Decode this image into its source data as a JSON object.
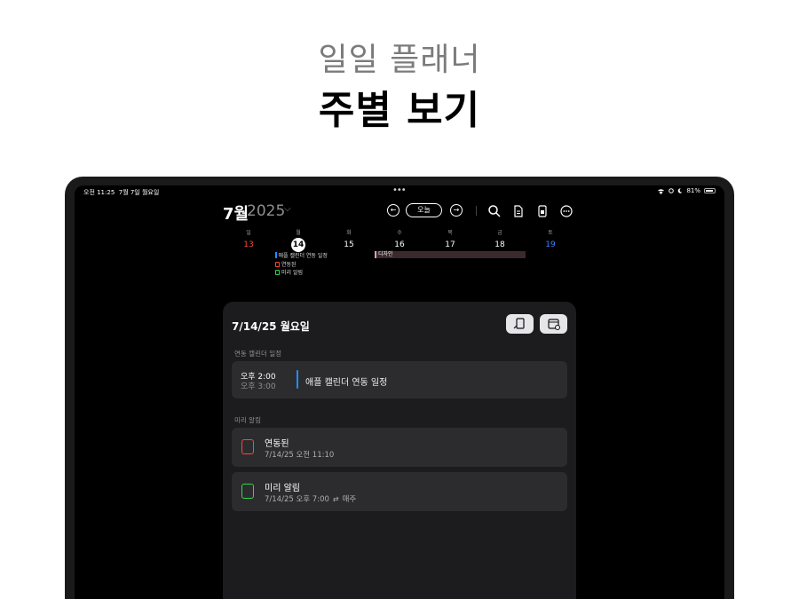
{
  "hero": {
    "subtitle": "일일 플래너",
    "title": "주별 보기"
  },
  "status_bar": {
    "time": "오전 11:25",
    "date": "7월 7일 월요일",
    "battery": "81%"
  },
  "toolbar": {
    "month": "7월",
    "year": "2025",
    "today_label": "오늘",
    "icons": [
      "prev-icon",
      "next-icon",
      "search-icon",
      "document-icon",
      "widget-icon",
      "more-icon"
    ]
  },
  "week": {
    "weekdays": [
      "일",
      "월",
      "화",
      "수",
      "목",
      "금",
      "토"
    ],
    "dates": [
      "13",
      "14",
      "15",
      "16",
      "17",
      "18",
      "19"
    ],
    "events": {
      "calendar_event": "애플 캘린더 연동 일정",
      "reminder1": "연동된",
      "reminder2": "미리 알림",
      "design": "디자인"
    }
  },
  "panel": {
    "date": "7/14/25 월요일",
    "calendar_section": "연동 캘린더 일정",
    "event": {
      "start": "오후 2:00",
      "end": "오후 3:00",
      "title": "애플 캘린더 연동 일정"
    },
    "reminder_section": "미리 알림",
    "reminders": [
      {
        "title": "연동된",
        "sub": "7/14/25 오전 11:10",
        "color": "#ff453a"
      },
      {
        "title": "미리 알림",
        "sub": "7/14/25 오후 7:00",
        "repeat": "매주",
        "color": "#32d74b"
      }
    ]
  },
  "colors": {
    "sunday": "#ff453a",
    "saturday": "#3a86ff",
    "calendar_accent": "#1e90ff"
  }
}
